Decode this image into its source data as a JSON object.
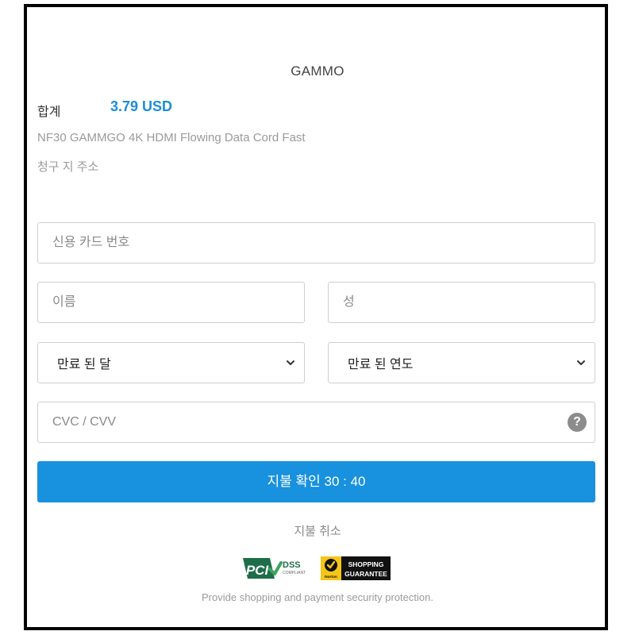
{
  "merchant": "GAMMO",
  "order": {
    "total_label": "합계",
    "total_amount": "3.79 USD",
    "product_name": "NF30 GAMMGO 4K HDMI Flowing Data Cord Fast",
    "billing_address_label": "청구 지 주소"
  },
  "form": {
    "card_number_placeholder": "신용 카드 번호",
    "first_name_placeholder": "이름",
    "last_name_placeholder": "성",
    "exp_month_label": "만료 된 달",
    "exp_year_label": "만료 된 연도",
    "cvc_placeholder": "CVC / CVV",
    "cvc_help": "?"
  },
  "actions": {
    "confirm_label": "지불 확인 30 : 40",
    "cancel_label": "지불 취소"
  },
  "badges": {
    "pci_text": "PCI",
    "dss_text": "DSS",
    "dss_sub": "COMPLIANT",
    "norton_top": "SHOPPING",
    "norton_bottom": "GUARANTEE",
    "norton_brand": "Norton"
  },
  "footer": {
    "security_text": "Provide shopping and payment security protection."
  },
  "colors": {
    "accent": "#1891de",
    "total": "#1b8ed8",
    "muted": "#9a9a9a"
  }
}
